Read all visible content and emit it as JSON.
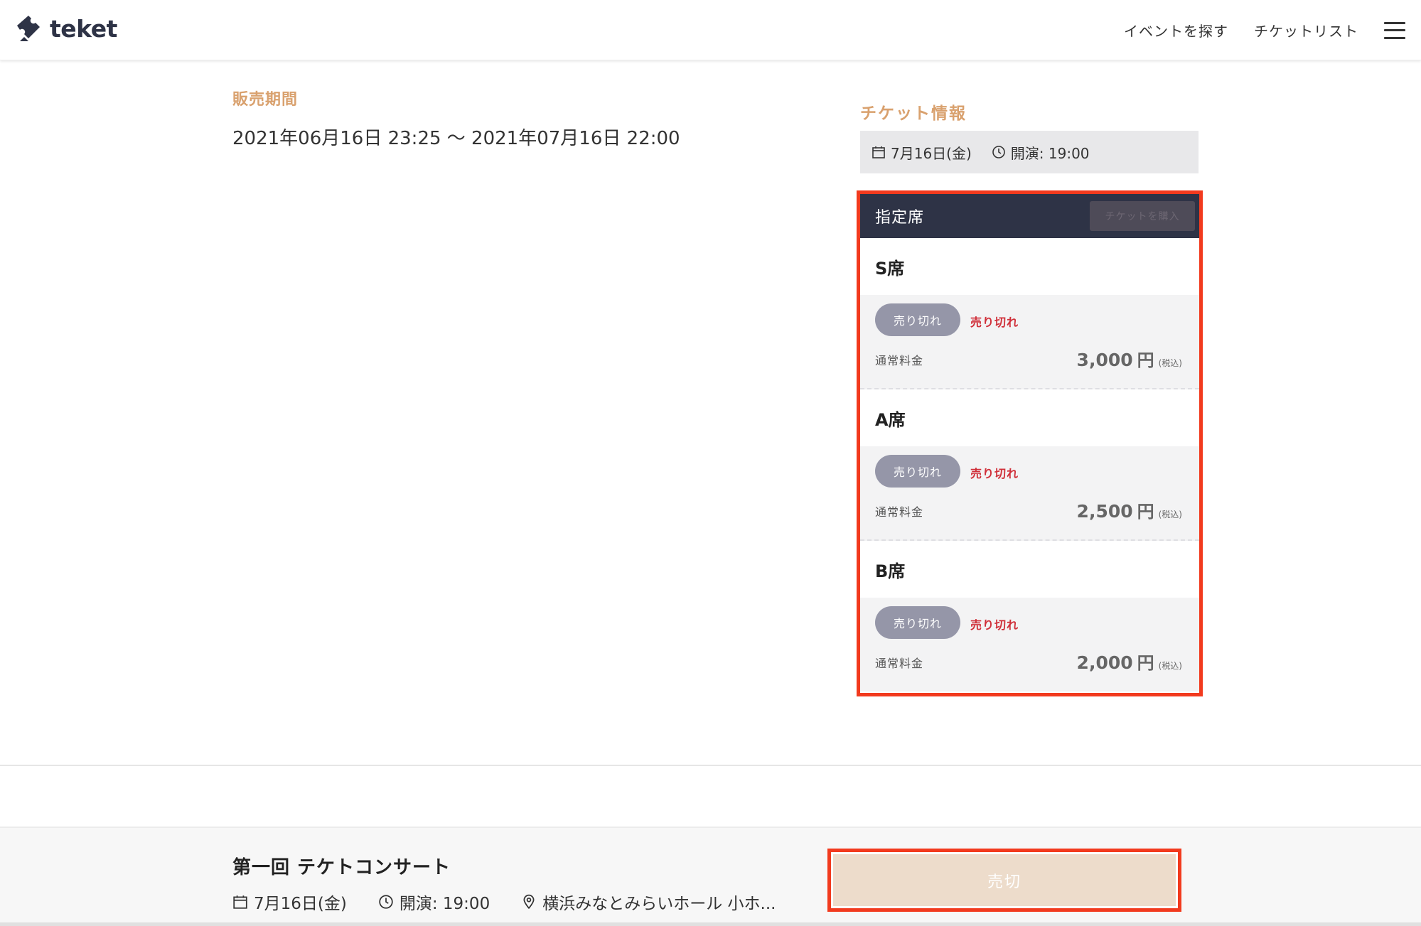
{
  "header": {
    "logo_text": "teket",
    "nav": [
      "イベントを探す",
      "チケットリスト"
    ]
  },
  "sales": {
    "title": "販売期間",
    "period": "2021年06月16日 23:25 〜 2021年07月16日 22:00"
  },
  "ticket_info": {
    "title": "チケット情報",
    "date": "7月16日(金)",
    "time": "開演: 19:00"
  },
  "ticket_box": {
    "category": "指定席",
    "buy_label": "チケットを購入",
    "seats": [
      {
        "name": "S席",
        "status_pill": "売り切れ",
        "status_text": "売り切れ",
        "fee_label": "通常料金",
        "price": "3,000",
        "currency": "円",
        "tax": "(税込)"
      },
      {
        "name": "A席",
        "status_pill": "売り切れ",
        "status_text": "売り切れ",
        "fee_label": "通常料金",
        "price": "2,500",
        "currency": "円",
        "tax": "(税込)"
      },
      {
        "name": "B席",
        "status_pill": "売り切れ",
        "status_text": "売り切れ",
        "fee_label": "通常料金",
        "price": "2,000",
        "currency": "円",
        "tax": "(税込)"
      }
    ]
  },
  "footer": {
    "event_title": "第一回 テケトコンサート",
    "date": "7月16日(金)",
    "time": "開演: 19:00",
    "venue": "横浜みなとみらいホール 小ホ...",
    "soldout_label": "売切"
  },
  "colors": {
    "accent": "#d9a16e",
    "navy": "#2e3346",
    "highlight_border": "#f23a1e",
    "soldout_red": "#d0303a"
  }
}
